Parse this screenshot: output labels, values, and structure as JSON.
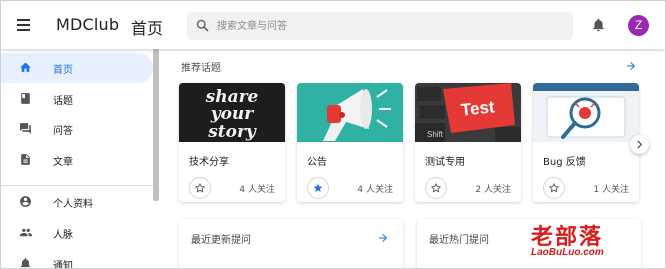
{
  "app": {
    "name": "MDClub",
    "page_title": "首页",
    "avatar_letter": "Z"
  },
  "search": {
    "placeholder": "搜索文章与问答"
  },
  "sidebar": {
    "items": [
      {
        "label": "首页",
        "icon": "home-icon",
        "active": true
      },
      {
        "label": "话题",
        "icon": "book-icon"
      },
      {
        "label": "问答",
        "icon": "forum-icon"
      },
      {
        "label": "文章",
        "icon": "article-icon"
      },
      {
        "label": "个人资料",
        "icon": "account-circle-icon"
      },
      {
        "label": "人脉",
        "icon": "people-icon"
      },
      {
        "label": "通知",
        "icon": "notifications-icon"
      }
    ]
  },
  "recommended": {
    "title": "推荐话题",
    "topics": [
      {
        "name": "技术分享",
        "followers": "4 人关注",
        "followed": false,
        "image_text": [
          "share",
          "your",
          "story"
        ]
      },
      {
        "name": "公告",
        "followers": "4 人关注",
        "followed": true
      },
      {
        "name": "测试专用",
        "followers": "2 人关注",
        "followed": false,
        "image_text": [
          "Test",
          "Shift"
        ]
      },
      {
        "name": "Bug 反馈",
        "followers": "1 人关注",
        "followed": false
      }
    ]
  },
  "panels": {
    "latest_questions": {
      "title": "最近更新提问"
    },
    "hot_questions": {
      "title": "最近热门提问"
    }
  },
  "watermark": {
    "cn": "老部落",
    "en": "LaoBuLuo.com"
  },
  "colors": {
    "accent": "#1a73e8",
    "active_bg": "#e8f0fe",
    "avatar": "#9c27b0",
    "watermark": "#d91c1c"
  }
}
